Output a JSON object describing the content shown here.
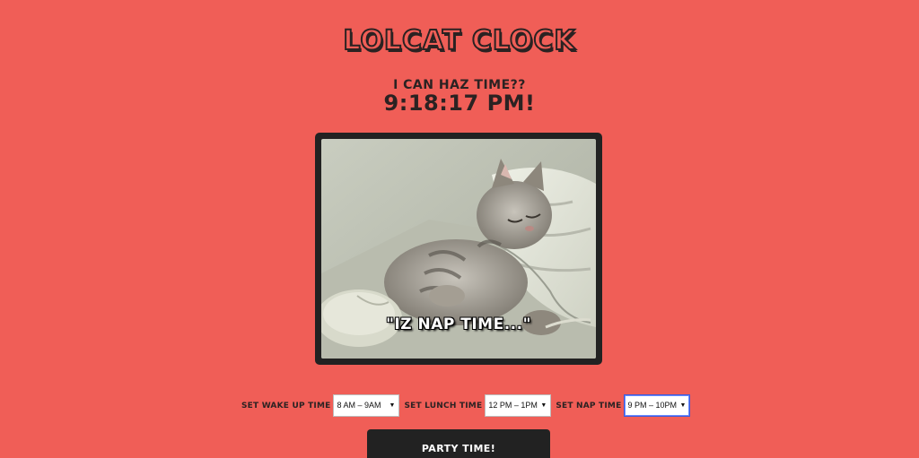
{
  "header": {
    "title": "Lolcat Clock",
    "subtitle": "I can haz time??",
    "clock_time": "9:18:17 PM!"
  },
  "photo": {
    "caption": "\"IZ NAP TIME...\"",
    "subject": "sleeping-kitten-on-mouse"
  },
  "controls": {
    "wake_label": "Set Wake Up Time",
    "wake_value": "8 AM – 9AM",
    "lunch_label": "Set Lunch Time",
    "lunch_value": "12 PM – 1PM",
    "nap_label": "Set Nap Time",
    "nap_value": "9 PM – 10PM",
    "caret_icon": "▼"
  },
  "party_button": {
    "label": "Party Time!"
  },
  "colors": {
    "background": "#f05e57",
    "ink": "#2b2222",
    "button": "#222222"
  }
}
